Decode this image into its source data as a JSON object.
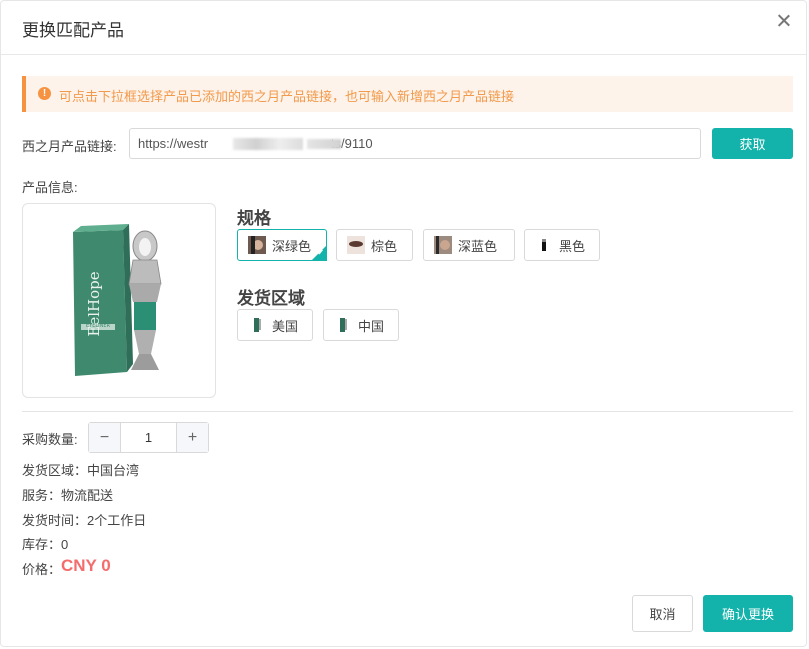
{
  "dialog": {
    "title": "更换匹配产品",
    "close_icon": "close-icon"
  },
  "alert": {
    "icon": "warning-circle-icon",
    "icon_glyph": "!",
    "text": "可点击下拉框选择产品已添加的西之月产品链接，也可输入新增西之月产品链接",
    "color": "#f29a4b"
  },
  "link": {
    "label": "西之月产品链接:",
    "value": "https://westr                                  ts/9110",
    "fetch_label": "获取"
  },
  "product": {
    "info_label": "产品信息:",
    "spec_title": "规格",
    "specs": [
      {
        "label": "深绿色",
        "selected": true
      },
      {
        "label": "棕色",
        "selected": false
      },
      {
        "label": "深蓝色",
        "selected": false
      },
      {
        "label": "黑色",
        "selected": false
      }
    ],
    "region_title": "发货区域",
    "regions": [
      {
        "label": "美国"
      },
      {
        "label": "中国"
      }
    ],
    "brand_text": "EelHope",
    "brand_subtext": "EYELINER"
  },
  "order": {
    "quantity_label": "采购数量:",
    "quantity": "1",
    "minus": "−",
    "plus": "+",
    "region": "发货区域：中国台湾",
    "service": "服务：物流配送",
    "ship_time": "发货时间：2个工作日",
    "stock": "库存：0",
    "price_label": "价格：",
    "price": "CNY 0"
  },
  "footer": {
    "cancel_label": "取消",
    "confirm_label": "确认更换"
  },
  "colors": {
    "accent": "#13b3ab",
    "warning": "#f59342",
    "price": "#f56c6c"
  }
}
